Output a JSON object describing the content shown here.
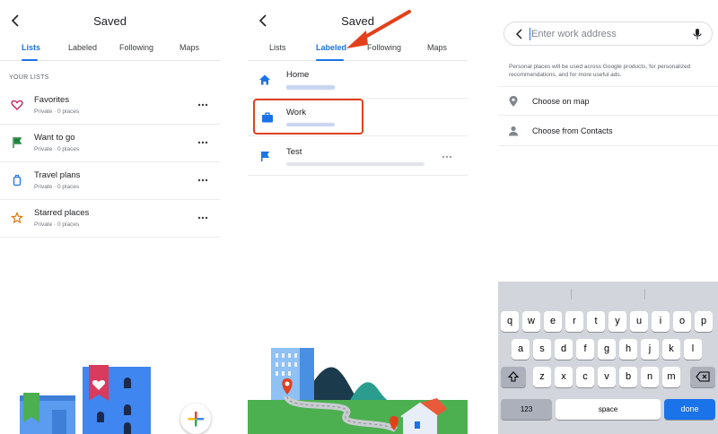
{
  "screen1": {
    "title": "Saved",
    "tabs": [
      {
        "label": "Lists",
        "active": true
      },
      {
        "label": "Labeled",
        "active": false
      },
      {
        "label": "Following",
        "active": false
      },
      {
        "label": "Maps",
        "active": false
      }
    ],
    "section_header": "YOUR LISTS",
    "lists": [
      {
        "title": "Favorites",
        "subtitle": "Private · 0 places",
        "icon": "heart-icon",
        "color": "#c2185b"
      },
      {
        "title": "Want to go",
        "subtitle": "Private · 0 places",
        "icon": "flag-icon",
        "color": "#188038"
      },
      {
        "title": "Travel plans",
        "subtitle": "Private · 0 places",
        "icon": "suitcase-icon",
        "color": "#1a73e8"
      },
      {
        "title": "Starred places",
        "subtitle": "Private · 0 places",
        "icon": "star-icon",
        "color": "#e37400"
      }
    ],
    "fab_icon": "plus-icon"
  },
  "screen2": {
    "title": "Saved",
    "tabs": [
      {
        "label": "Lists",
        "active": false
      },
      {
        "label": "Labeled",
        "active": true
      },
      {
        "label": "Following",
        "active": false
      },
      {
        "label": "Maps",
        "active": false
      }
    ],
    "labeled": [
      {
        "title": "Home",
        "icon": "home-icon"
      },
      {
        "title": "Work",
        "icon": "briefcase-icon"
      },
      {
        "title": "Test",
        "icon": "flag-icon"
      }
    ]
  },
  "screen3": {
    "placeholder": "Enter work address",
    "note": "Personal places will be used across Google products, for personalized recommendations, and for more useful ads.",
    "options": [
      {
        "label": "Choose on map",
        "icon": "map-pin-icon"
      },
      {
        "label": "Choose from Contacts",
        "icon": "person-icon"
      }
    ],
    "keyboard": {
      "row1": [
        "q",
        "w",
        "e",
        "r",
        "t",
        "y",
        "u",
        "i",
        "o",
        "p"
      ],
      "row2": [
        "a",
        "s",
        "d",
        "f",
        "g",
        "h",
        "j",
        "k",
        "l"
      ],
      "row3": [
        "z",
        "x",
        "c",
        "v",
        "b",
        "n",
        "m"
      ],
      "numbers_key": "123",
      "space_key": "space",
      "done_key": "done"
    }
  },
  "colors": {
    "accent": "#1a73e8",
    "highlight": "#e2401b"
  }
}
